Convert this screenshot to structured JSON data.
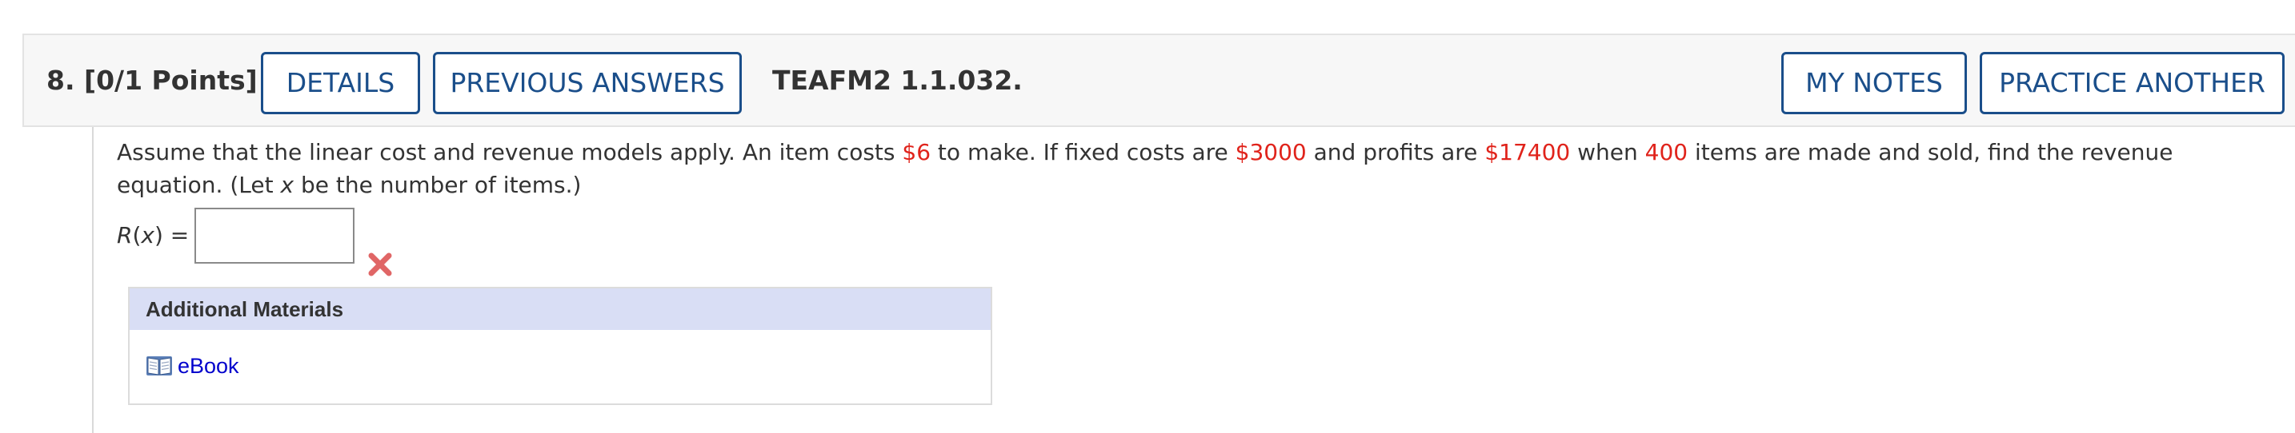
{
  "header": {
    "question_number": "8.",
    "points": "[0/1 Points]",
    "details_label": "DETAILS",
    "previous_answers_label": "PREVIOUS ANSWERS",
    "question_code": "TEAFM2 1.1.032.",
    "my_notes_label": "MY NOTES",
    "practice_another_label": "PRACTICE ANOTHER"
  },
  "question": {
    "part1": "Assume that the linear cost and revenue models apply. An item costs ",
    "item_cost": "$6",
    "part2": " to make. If fixed costs are ",
    "fixed_costs": "$3000",
    "part3": " and profits are ",
    "profits": "$17400",
    "part4": " when ",
    "items": "400",
    "part5": " items are made and sold, find the revenue equation. (Let ",
    "variable": "x",
    "part6": " be the number of items.)"
  },
  "answer": {
    "label_prefix": "R(",
    "label_var": "x",
    "label_suffix": ") =",
    "value": "",
    "status": "incorrect"
  },
  "materials": {
    "heading": "Additional Materials",
    "ebook_label": "eBook"
  },
  "colors": {
    "accent": "#1a4e8a",
    "highlight": "#e0231b",
    "wrong": "#e06666",
    "materials_header": "#d9def5",
    "link": "#0000cc"
  },
  "icons": {
    "wrong": "close-x-icon",
    "ebook": "book-icon"
  }
}
